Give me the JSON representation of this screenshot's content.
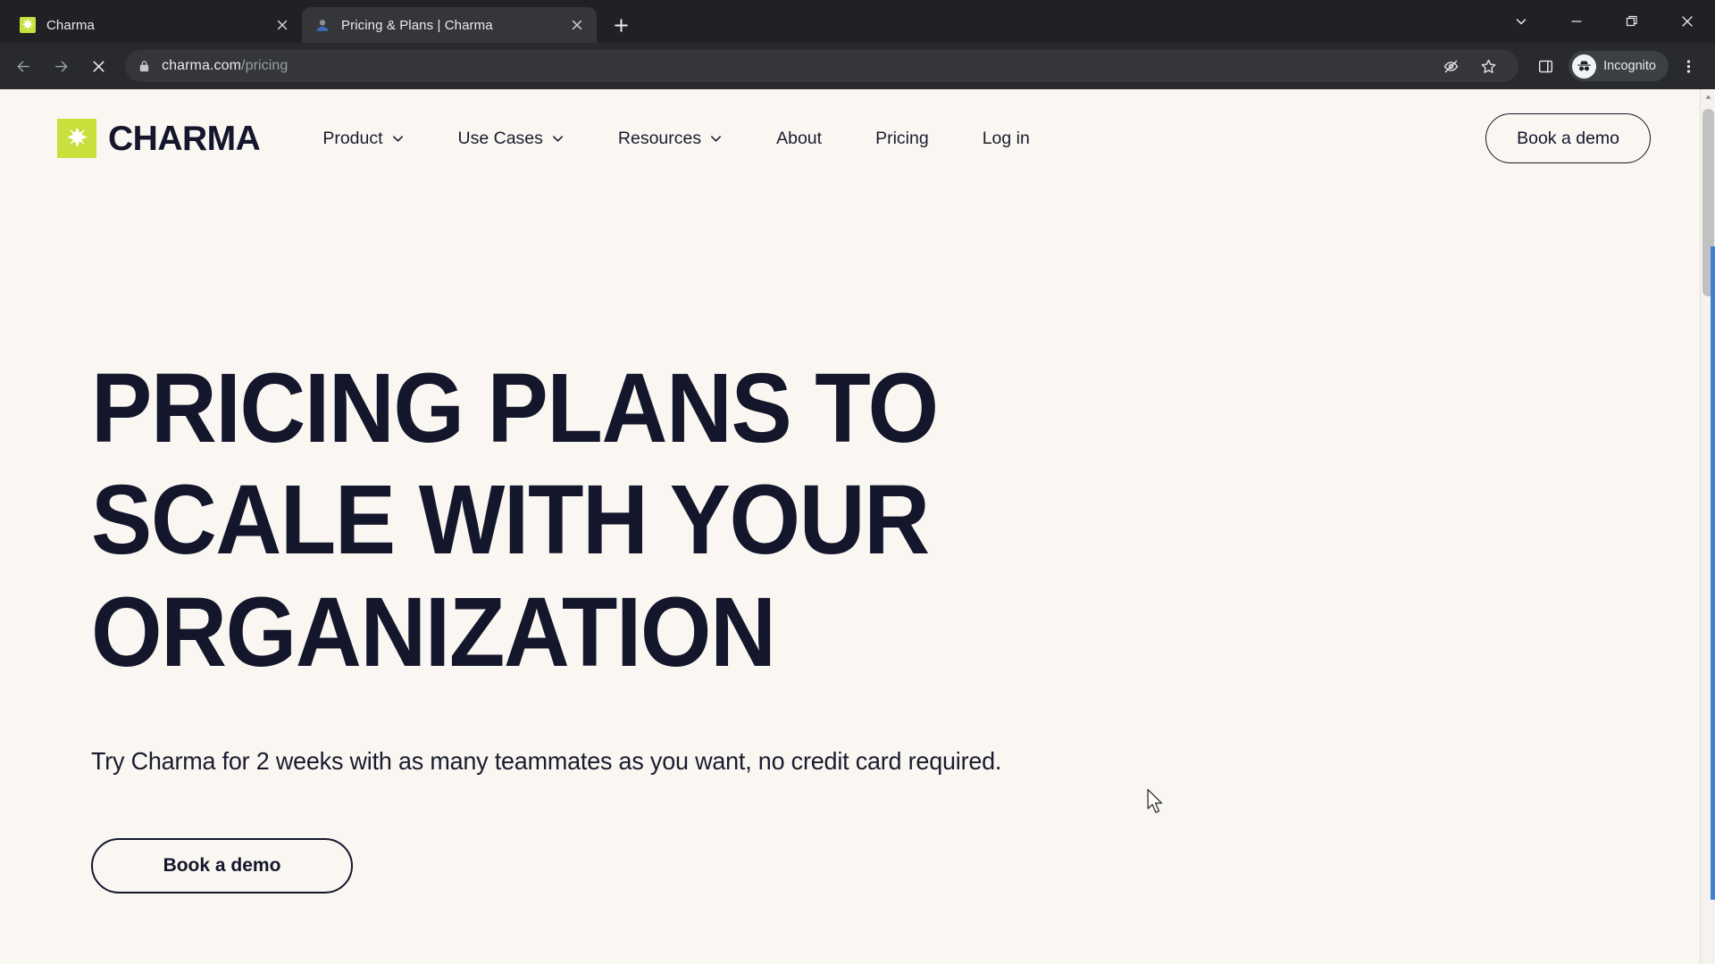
{
  "browser": {
    "tabs": [
      {
        "title": "Charma",
        "favicon": "charma-star-icon",
        "active": false
      },
      {
        "title": "Pricing & Plans | Charma",
        "favicon": "loading-page-icon",
        "active": true
      }
    ],
    "new_tab_label": "+",
    "window_controls": [
      "tab-search-chevron",
      "minimize",
      "restore",
      "close"
    ],
    "toolbar": {
      "back": "back-arrow",
      "forward": "forward-arrow",
      "stop": "stop-loading-x",
      "lock": "lock-icon",
      "url_domain": "charma.com",
      "url_path": "/pricing",
      "tracking_protection": "eye-slash-icon",
      "bookmark": "star-icon",
      "side_panel": "side-panel-icon",
      "profile_label": "Incognito",
      "menu": "three-dot-menu"
    }
  },
  "site": {
    "logo_text": "CHARMA",
    "nav": [
      {
        "label": "Product",
        "has_dropdown": true
      },
      {
        "label": "Use Cases",
        "has_dropdown": true
      },
      {
        "label": "Resources",
        "has_dropdown": true
      },
      {
        "label": "About",
        "has_dropdown": false
      },
      {
        "label": "Pricing",
        "has_dropdown": false
      },
      {
        "label": "Log in",
        "has_dropdown": false
      }
    ],
    "demo_button": "Book a demo"
  },
  "hero": {
    "title": "PRICING PLANS TO SCALE WITH YOUR ORGANIZATION",
    "subtitle": "Try Charma for 2 weeks with as many teammates as you want, no credit card required.",
    "cta_label": "Book a demo"
  },
  "colors": {
    "brand_lime": "#c8df3c",
    "ink": "#14162b",
    "page_bg": "#faf7f2",
    "chrome_bg": "#202124",
    "toolbar_bg": "#292a2d",
    "focus_blue": "#3f7fd4"
  }
}
